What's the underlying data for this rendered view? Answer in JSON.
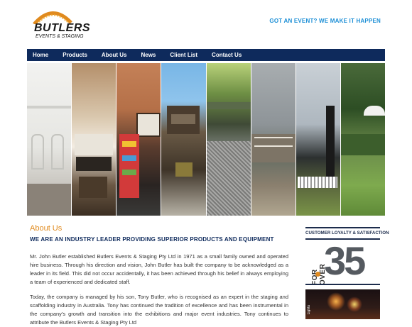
{
  "header": {
    "logo_brand": "BUTLERS",
    "logo_sub": "EVENTS & STAGING",
    "tagline": "GOT AN EVENT? WE MAKE IT HAPPEN"
  },
  "nav": {
    "items": [
      "Home",
      "Products",
      "About Us",
      "News",
      "Client List",
      "Contact Us"
    ]
  },
  "about": {
    "title": "About Us",
    "heading": "WE ARE AN INDUSTRY LEADER PROVIDING SUPERIOR PRODUCTS AND EQUIPMENT",
    "paragraph1": "Mr. John Butler established Butlers Events & Staging Pty Ltd in 1971 as a small family owned and operated hire business. Through his direction and vision, John Butler has built the company to be acknowledged as a leader in its field. This did not occur accidentally, it has been achieved through his belief in always employing a team of experienced and dedicated staff.",
    "paragraph2": "Today, the company is managed by his son, Tony Butler, who is recognised as an expert in the staging and scaffolding industry in Australia. Tony has continued the tradition of excellence and has been instrumental in the company's growth and transition into the exhibitions and major event industries. Tony continues to attribute the Butlers Events & Staging Pty Ltd"
  },
  "badge": {
    "title": "CUSTOMER LOYALTY & SATISFACTION",
    "for_over": "FOR OVER",
    "number": "35",
    "years": "YEARS"
  },
  "promo": {
    "label": "Lights"
  },
  "colors": {
    "nav_bg": "#0e2a5c",
    "accent_orange": "#e08a1e",
    "tagline_blue": "#1c8fd6"
  }
}
